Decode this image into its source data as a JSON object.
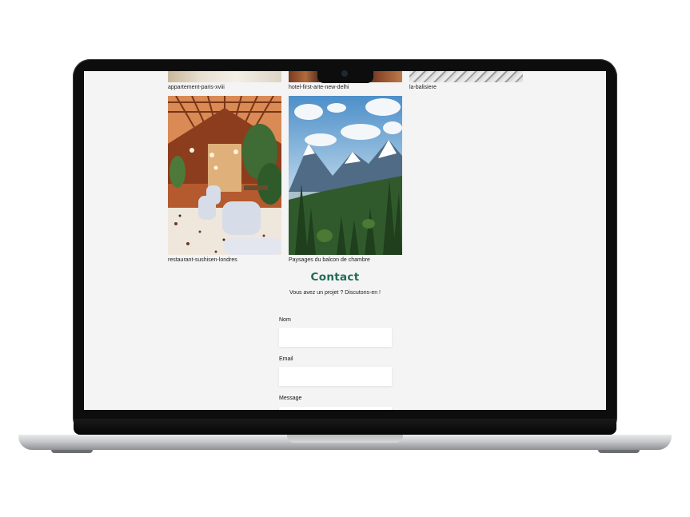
{
  "gallery": {
    "top_row": [
      {
        "caption": "appartement-paris-xviii"
      },
      {
        "caption": "hotel-first-arte-new-delhi"
      },
      {
        "caption": "la-balisiere"
      }
    ],
    "main_row": [
      {
        "caption": "restaurant-sushisen-londres"
      },
      {
        "caption": "Paysages du balcon de chambre"
      }
    ]
  },
  "contact": {
    "title": "Contact",
    "subtitle": "Vous avez un projet ? Discutons-en !",
    "fields": [
      {
        "label": "Nom",
        "value": ""
      },
      {
        "label": "Email",
        "value": ""
      },
      {
        "label": "Message",
        "value": ""
      }
    ]
  },
  "colors": {
    "accent": "#1f6b57",
    "page_background": "#f4f4f4"
  }
}
